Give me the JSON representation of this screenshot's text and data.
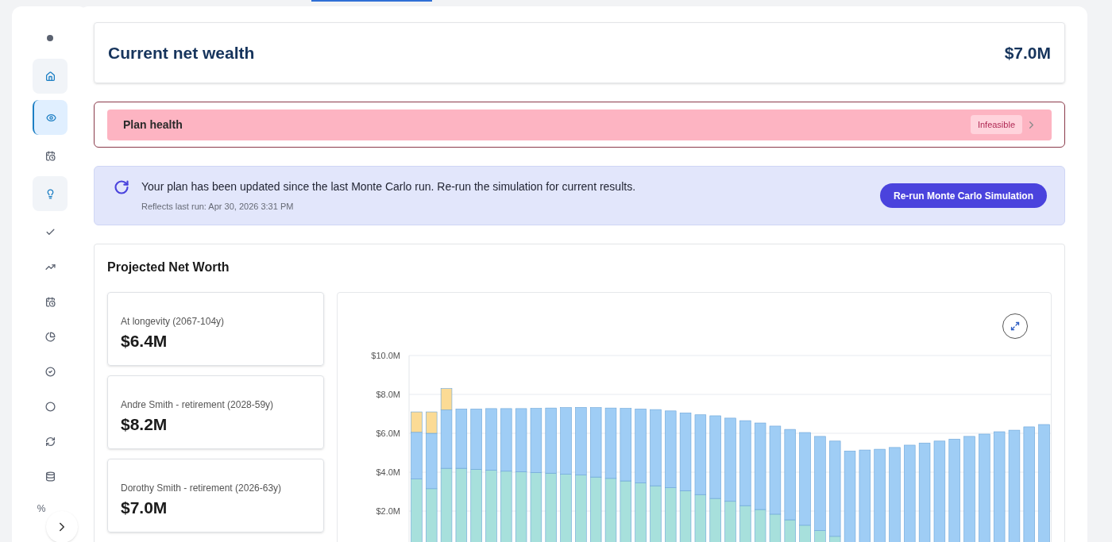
{
  "sidebar": {
    "items": [
      {
        "kind": "icon",
        "selected": false,
        "highlighted": false
      },
      {
        "kind": "icon",
        "selected": false,
        "highlighted": true
      },
      {
        "kind": "icon",
        "selected": true,
        "highlighted": false
      },
      {
        "kind": "icon",
        "selected": false,
        "highlighted": false
      },
      {
        "kind": "icon",
        "selected": false,
        "highlighted": true
      },
      {
        "kind": "icon",
        "selected": false,
        "highlighted": false
      },
      {
        "kind": "icon",
        "selected": false,
        "highlighted": false
      },
      {
        "kind": "icon",
        "selected": false,
        "highlighted": false
      },
      {
        "kind": "icon",
        "selected": false,
        "highlighted": false
      },
      {
        "kind": "icon",
        "selected": false,
        "highlighted": false
      },
      {
        "kind": "icon",
        "selected": false,
        "highlighted": false
      },
      {
        "kind": "icon",
        "selected": false,
        "highlighted": false
      },
      {
        "kind": "icon",
        "selected": false,
        "highlighted": false
      },
      {
        "kind": "text",
        "text": "%",
        "selected": false,
        "highlighted": false
      }
    ]
  },
  "net_wealth": {
    "label": "Current net wealth",
    "value": "$7.0M"
  },
  "plan_health": {
    "label": "Plan health",
    "status": "Infeasible"
  },
  "banner": {
    "message": "Your plan has been updated since the last Monte Carlo run. Re-run the simulation for current results.",
    "note": "Reflects last run: Apr 30, 2026 3:31 PM",
    "button": "Re-run Monte Carlo Simulation"
  },
  "projection": {
    "title": "Projected Net Worth",
    "stats": [
      {
        "label": "At longevity (2067-104y)",
        "value": "$6.4M"
      },
      {
        "label": "Andre Smith - retirement (2028-59y)",
        "value": "$8.2M"
      },
      {
        "label": "Dorothy Smith - retirement (2026-63y)",
        "value": "$7.0M"
      }
    ],
    "chart_data": {
      "type": "bar",
      "stacked": true,
      "grid": true,
      "ylim": [
        0,
        10
      ],
      "yticks": [
        {
          "value": 2,
          "label": "$2.0M"
        },
        {
          "value": 4,
          "label": "$4.0M"
        },
        {
          "value": 6,
          "label": "$6.0M"
        },
        {
          "value": 8,
          "label": "$8.0M"
        },
        {
          "value": 10,
          "label": "$10.0M"
        }
      ],
      "series": [
        {
          "color": "#a7e0dc",
          "values": [
            3.65,
            3.15,
            4.2,
            4.2,
            4.15,
            4.1,
            4.05,
            4.02,
            3.98,
            3.95,
            3.9,
            3.85,
            3.75,
            3.68,
            3.55,
            3.45,
            3.3,
            3.2,
            3.05,
            2.85,
            2.65,
            2.5,
            2.28,
            2.08,
            1.84,
            1.55,
            1.27,
            1.0,
            0.7,
            0,
            0,
            0,
            0,
            0,
            0,
            0,
            0,
            0,
            0,
            0,
            0,
            0,
            0
          ]
        },
        {
          "color": "#9fcdf5",
          "values": [
            2.4,
            2.85,
            3.0,
            3.05,
            3.1,
            3.17,
            3.22,
            3.25,
            3.3,
            3.35,
            3.42,
            3.48,
            3.57,
            3.62,
            3.73,
            3.8,
            3.92,
            3.95,
            4.0,
            4.1,
            4.25,
            4.28,
            4.37,
            4.45,
            4.53,
            4.65,
            4.77,
            4.84,
            4.9,
            5.09,
            5.14,
            5.18,
            5.27,
            5.39,
            5.5,
            5.6,
            5.7,
            5.84,
            5.96,
            6.08,
            6.16,
            6.33,
            6.45
          ]
        },
        {
          "color": "#fbdb95",
          "values": [
            1.05,
            1.1,
            1.1,
            0,
            0,
            0,
            0,
            0,
            0,
            0,
            0,
            0,
            0,
            0,
            0,
            0,
            0,
            0,
            0,
            0,
            0,
            0,
            0,
            0,
            0,
            0,
            0,
            0,
            0,
            0,
            0,
            0,
            0,
            0,
            0,
            0,
            0,
            0,
            0,
            0,
            0,
            0,
            0
          ]
        }
      ]
    }
  }
}
